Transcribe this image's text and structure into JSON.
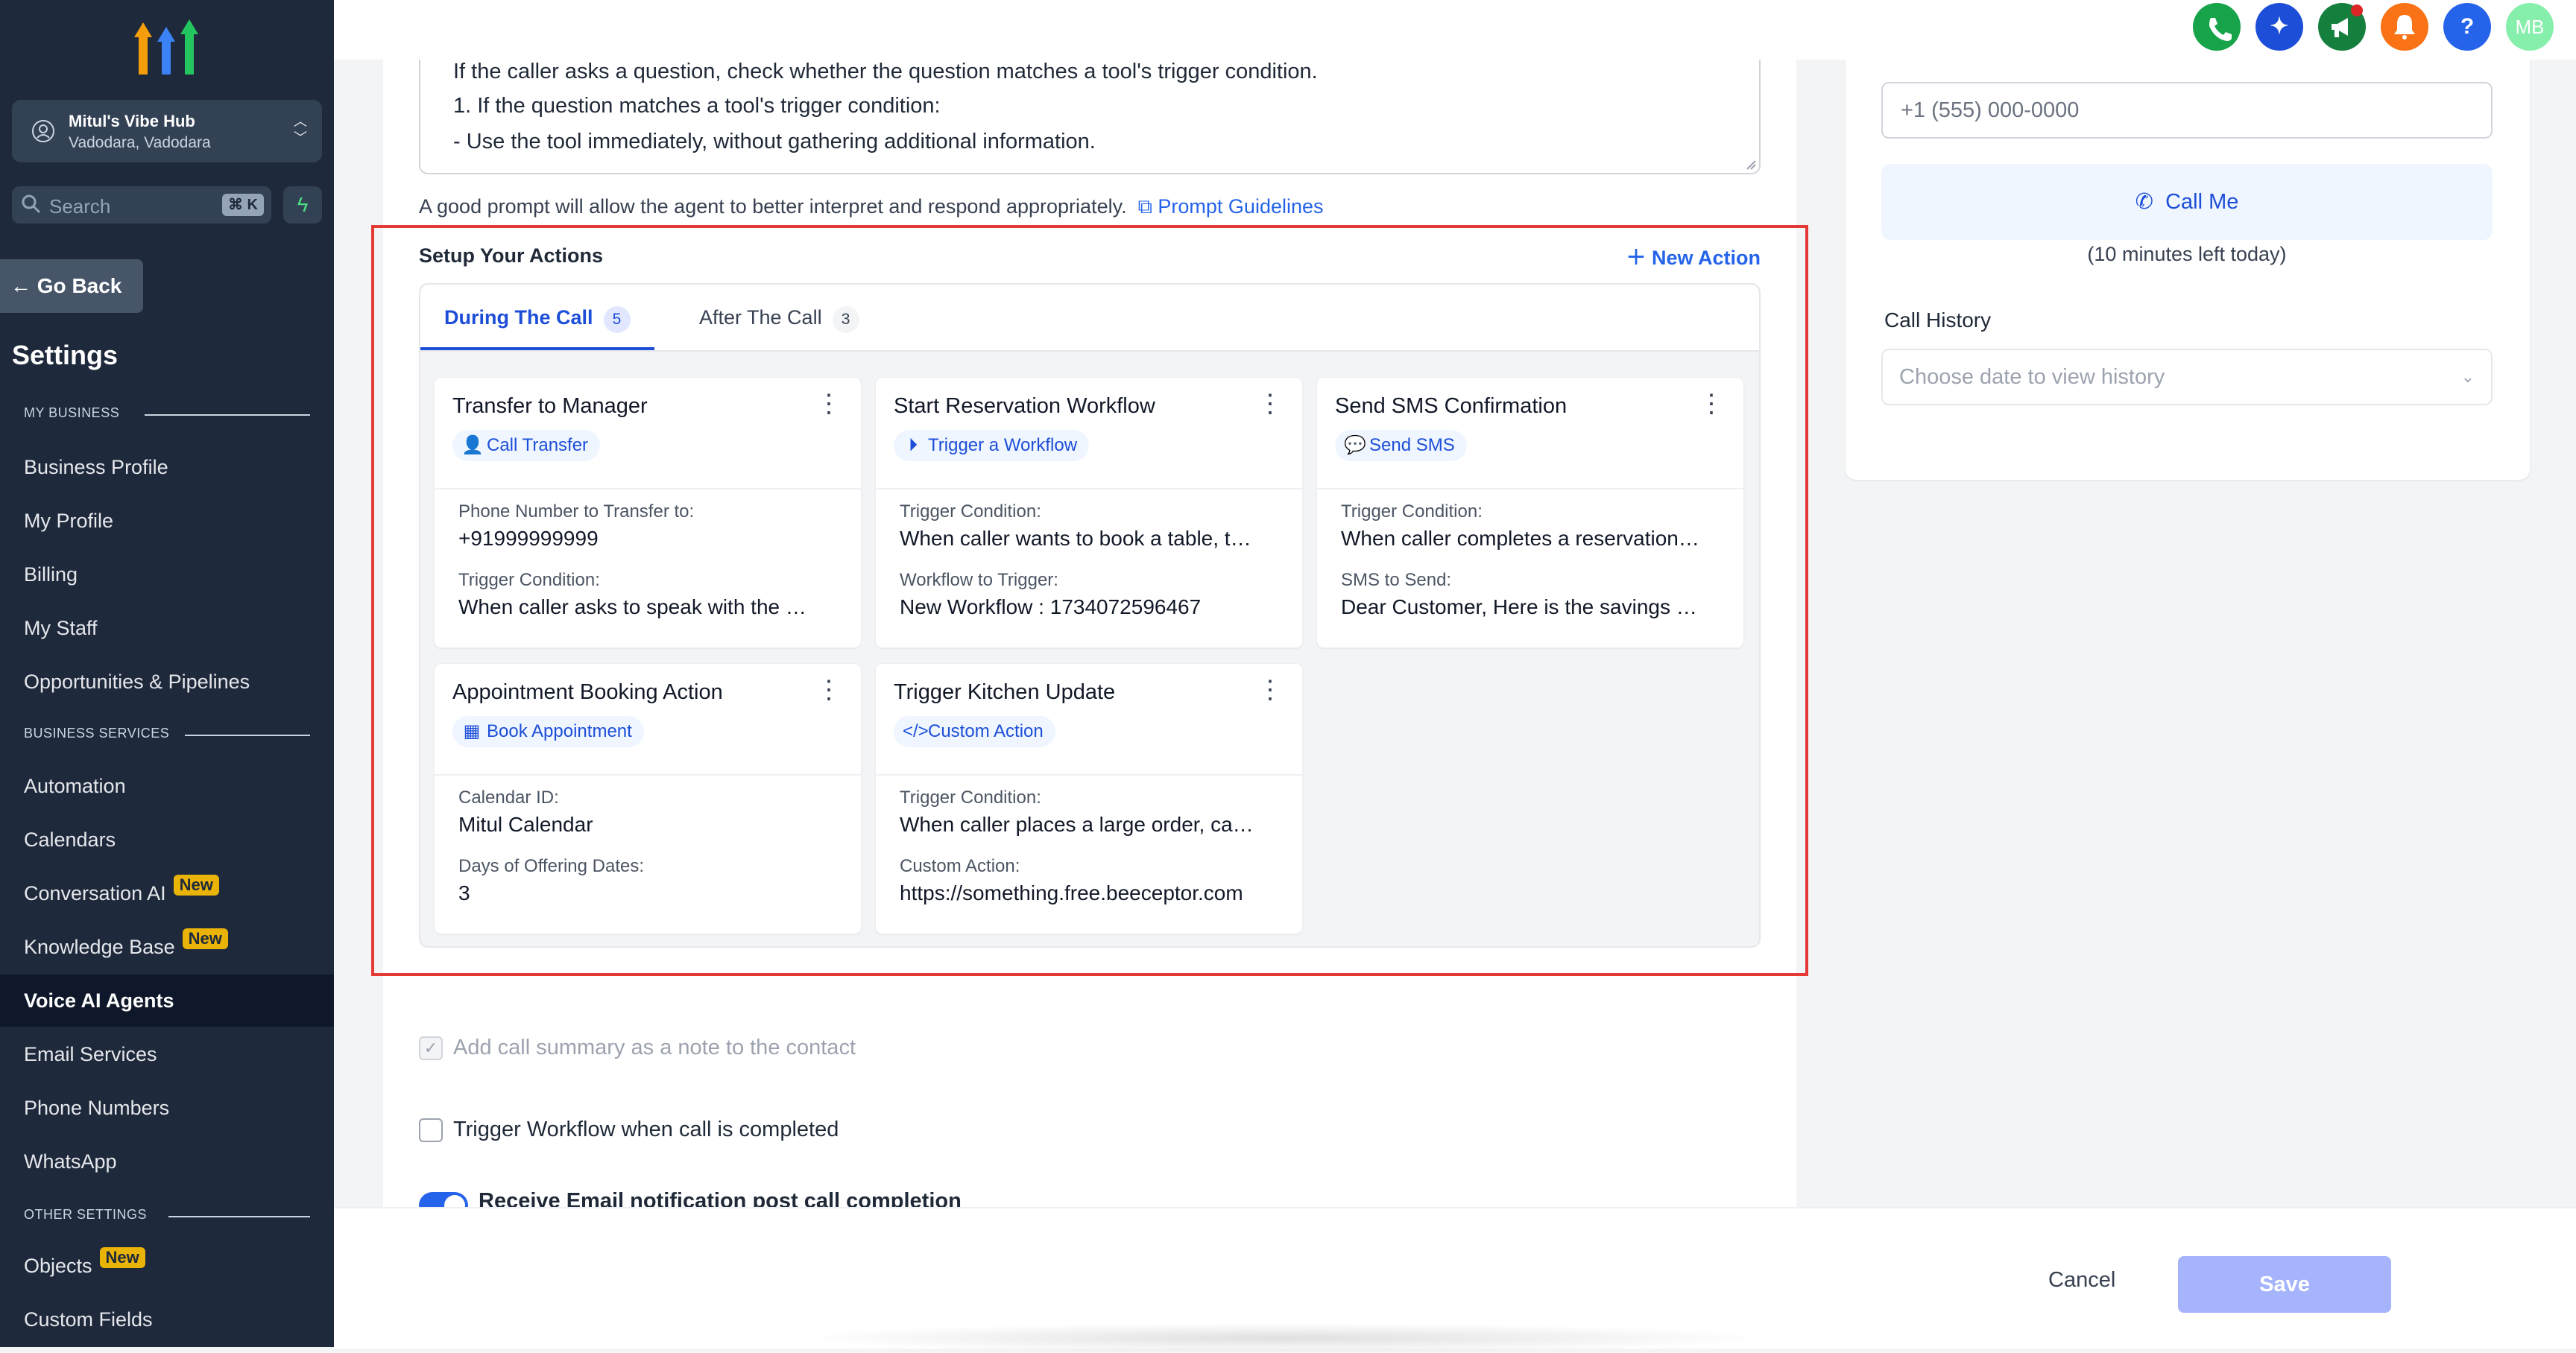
{
  "colors": {
    "sidebar_bg": "#1e293b",
    "accent": "#2563eb",
    "highlight": "#e53935",
    "badge_new": "#eab308"
  },
  "topbar": {
    "buttons": [
      {
        "name": "phone-icon",
        "color": "#16a34a",
        "glyph": "✆"
      },
      {
        "name": "sparkle-icon",
        "color": "#1d4ed8",
        "glyph": "✦"
      },
      {
        "name": "megaphone-icon",
        "color": "#15803d",
        "glyph": "📣"
      },
      {
        "name": "bell-icon",
        "color": "#f97316",
        "glyph": "🔔"
      },
      {
        "name": "help-icon",
        "color": "#2563eb",
        "glyph": "?"
      }
    ],
    "avatar_initials": "MB"
  },
  "sidebar": {
    "location_name": "Mitul's Vibe Hub",
    "location_sub": "Vadodara, Vadodara",
    "search_label": "Search",
    "search_shortcut": "⌘ K",
    "go_back": "Go Back",
    "settings_title": "Settings",
    "section_my_business": "MY BUSINESS",
    "section_business_services": "BUSINESS SERVICES",
    "section_other_settings": "OTHER SETTINGS",
    "new_badge": "New",
    "items": {
      "business_profile": "Business Profile",
      "my_profile": "My Profile",
      "billing": "Billing",
      "my_staff": "My Staff",
      "opportunities": "Opportunities & Pipelines",
      "automation": "Automation",
      "calendars": "Calendars",
      "conversation_ai": "Conversation AI",
      "knowledge_base": "Knowledge Base",
      "voice_ai_agents": "Voice AI Agents",
      "email_services": "Email Services",
      "phone_numbers": "Phone Numbers",
      "whatsapp": "WhatsApp",
      "objects": "Objects",
      "custom_fields": "Custom Fields"
    }
  },
  "prompt": {
    "lines": [
      "If the caller asks a question, check whether the question matches a tool's trigger condition.",
      "1. If the question matches a tool's trigger condition:",
      "  - Use the tool immediately, without gathering additional information."
    ],
    "hint": "A good prompt will allow the agent to better interpret and respond appropriately.",
    "guidelines_link": "Prompt Guidelines"
  },
  "actions": {
    "title": "Setup Your Actions",
    "new_action": "New Action",
    "tabs": [
      {
        "label": "During The Call",
        "count": "5"
      },
      {
        "label": "After The Call",
        "count": "3"
      }
    ],
    "cards": [
      {
        "title": "Transfer to Manager",
        "tag": "Call Transfer",
        "fields": [
          {
            "label": "Phone Number to Transfer to:",
            "value": "+91999999999"
          },
          {
            "label": "Trigger Condition:",
            "value": "When caller asks to speak with the …"
          }
        ]
      },
      {
        "title": "Start Reservation Workflow",
        "tag": "Trigger a Workflow",
        "fields": [
          {
            "label": "Trigger Condition:",
            "value": "When caller wants to book a table, t…"
          },
          {
            "label": "Workflow to Trigger:",
            "value": "New Workflow : 1734072596467"
          }
        ]
      },
      {
        "title": "Send SMS Confirmation",
        "tag": "Send SMS",
        "fields": [
          {
            "label": "Trigger Condition:",
            "value": "When caller completes a reservation…"
          },
          {
            "label": "SMS to Send:",
            "value": "Dear Customer, Here is the savings …"
          }
        ]
      },
      {
        "title": "Appointment Booking Action",
        "tag": "Book Appointment",
        "fields": [
          {
            "label": "Calendar ID:",
            "value": "Mitul Calendar"
          },
          {
            "label": "Days of Offering Dates:",
            "value": "3"
          }
        ]
      },
      {
        "title": "Trigger Kitchen Update",
        "tag": "Custom Action",
        "fields": [
          {
            "label": "Trigger Condition:",
            "value": "When caller places a large order, ca…"
          },
          {
            "label": "Custom Action:",
            "value": "https://something.free.beeceptor.com"
          }
        ]
      }
    ]
  },
  "options": {
    "call_summary": "Add call summary as a note to the contact",
    "trigger_workflow": "Trigger Workflow when call is completed",
    "email_notification": "Receive Email notification post call completion"
  },
  "footer": {
    "cancel": "Cancel",
    "save": "Save"
  },
  "right_panel": {
    "phone_placeholder": "+1 (555) 000-0000",
    "call_me": "Call Me",
    "minutes_left": "(10 minutes left today)",
    "call_history_label": "Call History",
    "history_placeholder": "Choose date to view history"
  }
}
